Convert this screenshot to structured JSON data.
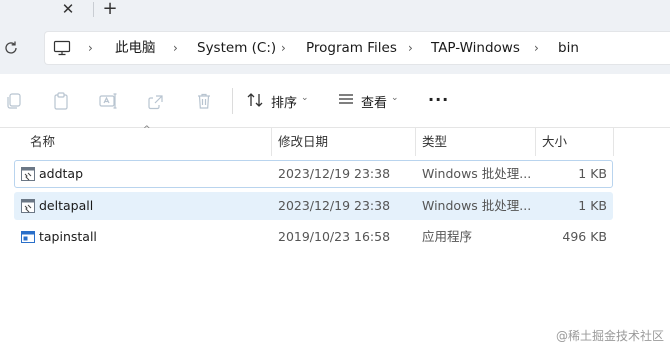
{
  "tabs": {
    "close_glyph": "✕",
    "new_glyph": "+"
  },
  "breadcrumb": {
    "items": [
      "此电脑",
      "System (C:)",
      "Program Files",
      "TAP-Windows",
      "bin"
    ],
    "separator": "›"
  },
  "toolbar": {
    "sort_label": "排序",
    "view_label": "查看",
    "more_label": "···",
    "dropdown_glyph": "⌄"
  },
  "columns": {
    "name": "名称",
    "date": "修改日期",
    "type": "类型",
    "size": "大小",
    "sort_glyph": "^"
  },
  "files": [
    {
      "name": "addtap",
      "date": "2023/12/19 23:38",
      "type": "Windows 批处理...",
      "size": "1 KB",
      "icon": "batch-file-icon"
    },
    {
      "name": "deltapall",
      "date": "2023/12/19 23:38",
      "type": "Windows 批处理...",
      "size": "1 KB",
      "icon": "batch-file-icon"
    },
    {
      "name": "tapinstall",
      "date": "2019/10/23 16:58",
      "type": "应用程序",
      "size": "496 KB",
      "icon": "application-icon"
    }
  ],
  "watermark": "@稀土掘金技术社区",
  "colors": {
    "accent": "#0067c0",
    "selection": "#e5f1fb",
    "chrome": "#eef1f5"
  }
}
